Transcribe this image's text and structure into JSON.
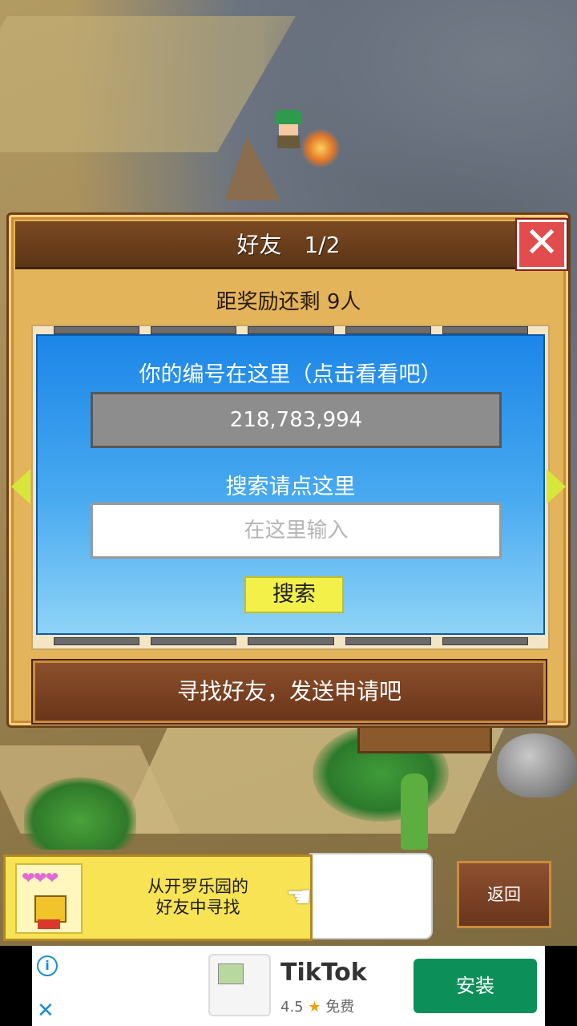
{
  "dialog": {
    "title": "好友　1/2",
    "reward_text": "距奖励还剩 9人",
    "id_label": "你的编号在这里（点击看看吧）",
    "id_value": "218,783,994",
    "search_label": "搜索请点这里",
    "search_placeholder": "在这里输入",
    "search_button": "搜索",
    "find_friends_button": "寻找好友，发送申请吧"
  },
  "bottom_bar": {
    "cairo_line1": "从开罗乐园的",
    "cairo_line2": "好友中寻找",
    "hearts": "❤❤❤",
    "back_button": "返回"
  },
  "ad": {
    "app_name": "TikTok",
    "rating": "4.5",
    "price": "免费",
    "install_button": "安装"
  },
  "colors": {
    "panel_blue": "#1c86e8",
    "dialog_gold": "#e3b45a",
    "close_red": "#e24c4c",
    "install_green": "#0d8f5a"
  }
}
